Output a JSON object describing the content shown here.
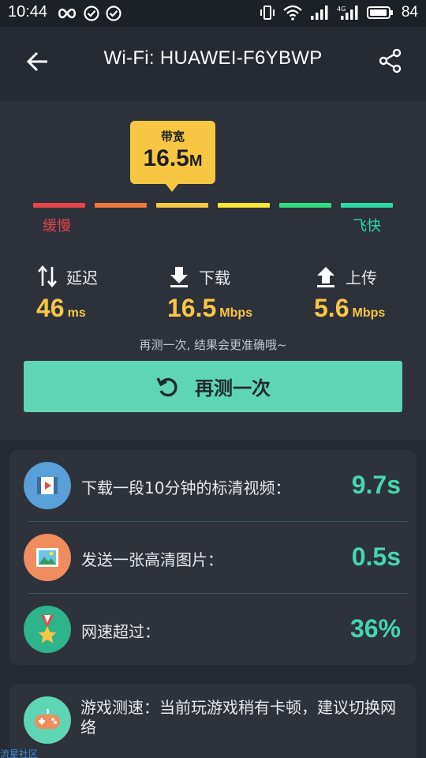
{
  "status_bar": {
    "time": "10:44",
    "battery": "84",
    "left_icons": [
      "infinity-icon",
      "check-circle-icon",
      "check-circle-icon"
    ],
    "right_icons": [
      "vibrate-icon",
      "wifi-icon",
      "signal-icon",
      "4g-signal-icon",
      "battery-icon"
    ]
  },
  "header": {
    "title": "Wi-Fi: HUAWEI-F6YBWP"
  },
  "bandwidth": {
    "label": "带宽",
    "value": "16.5",
    "unit": "M",
    "scale_slow": "缓慢",
    "scale_fast": "飞快",
    "scale_colors": [
      "#e8434d",
      "#f07a3c",
      "#f7c744",
      "#f7e633",
      "#2fdc7f",
      "#2edba6"
    ],
    "active_segment": 2
  },
  "metrics": [
    {
      "label": "延迟",
      "value": "46",
      "unit": "ms",
      "icon": "up-down-arrows-icon"
    },
    {
      "label": "下载",
      "value": "16.5",
      "unit": "Mbps",
      "icon": "download-icon"
    },
    {
      "label": "上传",
      "value": "5.6",
      "unit": "Mbps",
      "icon": "upload-icon"
    }
  ],
  "retry": {
    "hint": "再测一次, 结果会更准确哦~",
    "button_label": "再测一次"
  },
  "estimates": [
    {
      "text": "下载一段10分钟的标清视频：",
      "value": "9.7s",
      "icon": "video-icon",
      "color": "#5aa0d8"
    },
    {
      "text": "发送一张高清图片：",
      "value": "0.5s",
      "icon": "image-icon",
      "color": "#f08c5e"
    },
    {
      "text": "网速超过：",
      "value": "36%",
      "icon": "medal-icon",
      "color": "#2eb38a"
    }
  ],
  "game": {
    "text": "游戏测速：当前玩游戏稍有卡顿，建议切换网络",
    "icon": "gamepad-icon"
  },
  "watermark": "流星社区"
}
